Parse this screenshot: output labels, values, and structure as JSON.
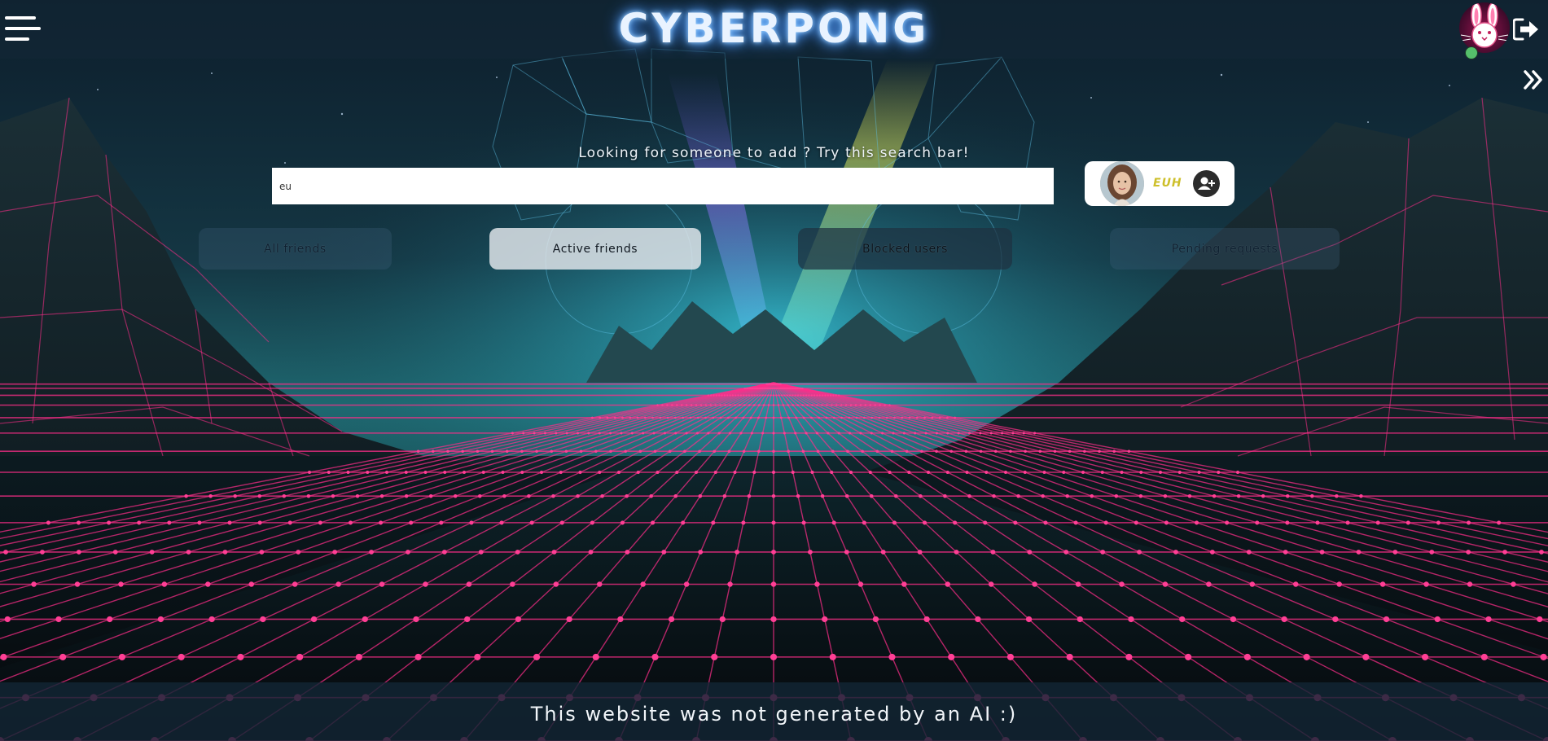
{
  "header": {
    "title": "CYBERPONG",
    "menu_icon": "hamburger-menu-icon",
    "avatar_icon": "bunny-avatar-icon",
    "status": "online",
    "status_color": "#55c06b",
    "logout_icon": "logout-icon",
    "drawer_icon": "double-chevron-right-icon"
  },
  "search": {
    "hint": "Looking for someone to add ? Try this search bar!",
    "value": "eu",
    "placeholder": ""
  },
  "search_result": {
    "name": "EUH",
    "name_color": "#cdbf2a",
    "action_icon": "add-user-icon"
  },
  "tabs": [
    {
      "label": "All friends",
      "state": "default"
    },
    {
      "label": "Active friends",
      "state": "selected"
    },
    {
      "label": "Blocked users",
      "state": "default"
    },
    {
      "label": "Pending requests",
      "state": "default"
    }
  ],
  "footer": {
    "text": "This website was not generated by an AI :)"
  },
  "theme": {
    "grid_color": "#ff2d8a",
    "glow_color": "#5aa9ff"
  }
}
